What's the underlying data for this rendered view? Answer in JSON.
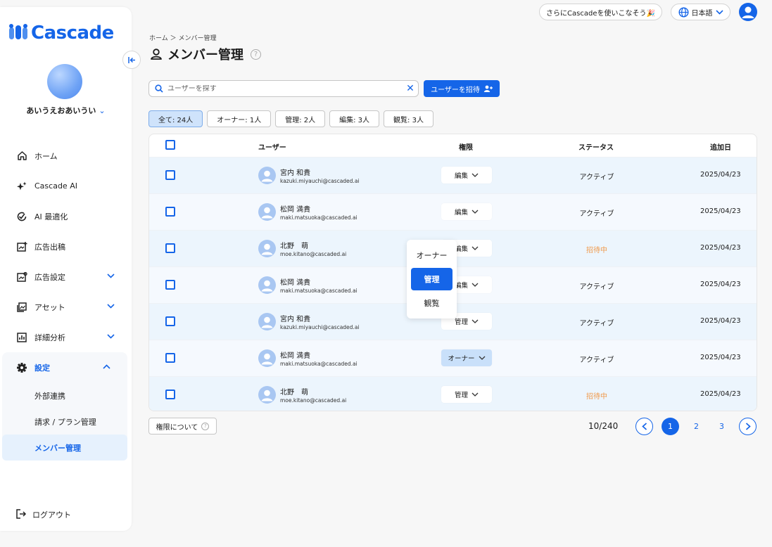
{
  "brand": {
    "name": "Cascade",
    "color": "#1565e8"
  },
  "header": {
    "promo_label": "さらにCascadeを使いこなそう🎉",
    "language_label": "日本語",
    "language_icon": "globe-icon",
    "account_icon": "user-circle-icon"
  },
  "sidebar": {
    "user_name": "あいうえおあいうい",
    "items": [
      {
        "label": "ホーム",
        "icon": "home-icon"
      },
      {
        "label": "Cascade AI",
        "icon": "sparkle-icon"
      },
      {
        "label": "AI 最適化",
        "icon": "ai-optimize-icon"
      },
      {
        "label": "広告出稿",
        "icon": "ad-publish-icon"
      },
      {
        "label": "広告設定",
        "icon": "ad-settings-icon"
      },
      {
        "label": "アセット",
        "icon": "image-asset-icon"
      },
      {
        "label": "詳細分析",
        "icon": "chart-icon"
      }
    ],
    "settings": {
      "label": "設定",
      "icon": "gear-icon",
      "sub_items": [
        "外部連携",
        "請求 / プラン管理",
        "メンバー管理"
      ],
      "active": "メンバー管理"
    },
    "logout_label": "ログアウト"
  },
  "page": {
    "breadcrumb": "ホーム ＞ メンバー管理",
    "title": "メンバー管理"
  },
  "search": {
    "placeholder": "ユーザーを探す",
    "value": ""
  },
  "invite_label": "ユーザーを招待",
  "filters": [
    {
      "label": "全て: 24人",
      "active": true
    },
    {
      "label": "オーナー: 1人",
      "active": false
    },
    {
      "label": "管理: 2人",
      "active": false
    },
    {
      "label": "編集: 3人",
      "active": false
    },
    {
      "label": "観覧: 3人",
      "active": false
    }
  ],
  "table": {
    "columns": [
      "ユーザー",
      "権限",
      "ステータス",
      "追加日"
    ],
    "rows": [
      {
        "name": "宮内 和貴",
        "email": "kazuki.miyauchi@cascaded.ai",
        "role": "編集",
        "status": "アクティブ",
        "date": "2025/04/23"
      },
      {
        "name": "松岡 満貴",
        "email": "maki.matsuoka@cascaded.ai",
        "role": "編集",
        "status": "アクティブ",
        "date": "2025/04/23"
      },
      {
        "name": "北野　萌",
        "email": "moe.kitano@cascaded.ai",
        "role": "編集",
        "status": "招待中",
        "date": "2025/04/23"
      },
      {
        "name": "松岡 満貴",
        "email": "maki.matsuoka@cascaded.ai",
        "role": "編集",
        "status": "アクティブ",
        "date": "2025/04/23"
      },
      {
        "name": "宮内 和貴",
        "email": "kazuki.miyauchi@cascaded.ai",
        "role": "管理",
        "status": "アクティブ",
        "date": "2025/04/23"
      },
      {
        "name": "松岡 満貴",
        "email": "maki.matsuoka@cascaded.ai",
        "role": "オーナー",
        "status": "アクティブ",
        "date": "2025/04/23"
      },
      {
        "name": "北野　萌",
        "email": "moe.kitano@cascaded.ai",
        "role": "管理",
        "status": "招待中",
        "date": "2025/04/23"
      }
    ]
  },
  "role_menu": {
    "options": [
      "オーナー",
      "管理",
      "観覧"
    ],
    "selected": "管理"
  },
  "footer": {
    "permissions_label": "権限について",
    "count": "10/240",
    "pages": [
      "1",
      "2",
      "3"
    ],
    "current_page": "1"
  },
  "colors": {
    "invited": "#f09a4c",
    "row_highlight": "#ecf5fd",
    "active_chip": "#cfe3fb"
  }
}
